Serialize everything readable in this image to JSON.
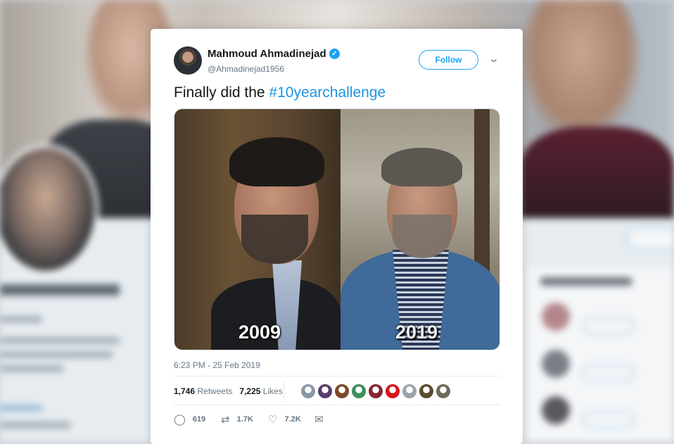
{
  "tweet": {
    "author_name": "Mahmoud Ahmadinejad",
    "handle": "@Ahmadinejad1956",
    "follow_label": "Follow",
    "text_prefix": "Finally did the",
    "hashtag": "#10yearchallenge",
    "photo_labels": [
      "2009",
      "2019"
    ],
    "timestamp": "6:23 PM - 25 Feb 2019",
    "retweets_count": "1,746",
    "retweets_label": "Retweets",
    "likes_count": "7,225",
    "likes_label": "Likes",
    "likers": [
      {
        "color": "#8899a6"
      },
      {
        "color": "#5a3b6b"
      },
      {
        "color": "#7a4a2a"
      },
      {
        "color": "#3e8e5a"
      },
      {
        "color": "#8a2432"
      },
      {
        "color": "#d8161b"
      },
      {
        "color": "#9aa4ad"
      },
      {
        "color": "#5d4b2e"
      },
      {
        "color": "#6d6a5a"
      }
    ],
    "actions": {
      "reply_count": "619",
      "retweet_count": "1.7K",
      "like_count": "7.2K"
    }
  },
  "colors": {
    "accent": "#1da1f2",
    "hashtag": "#1b95e0",
    "text": "#14171a",
    "muted": "#657786"
  }
}
